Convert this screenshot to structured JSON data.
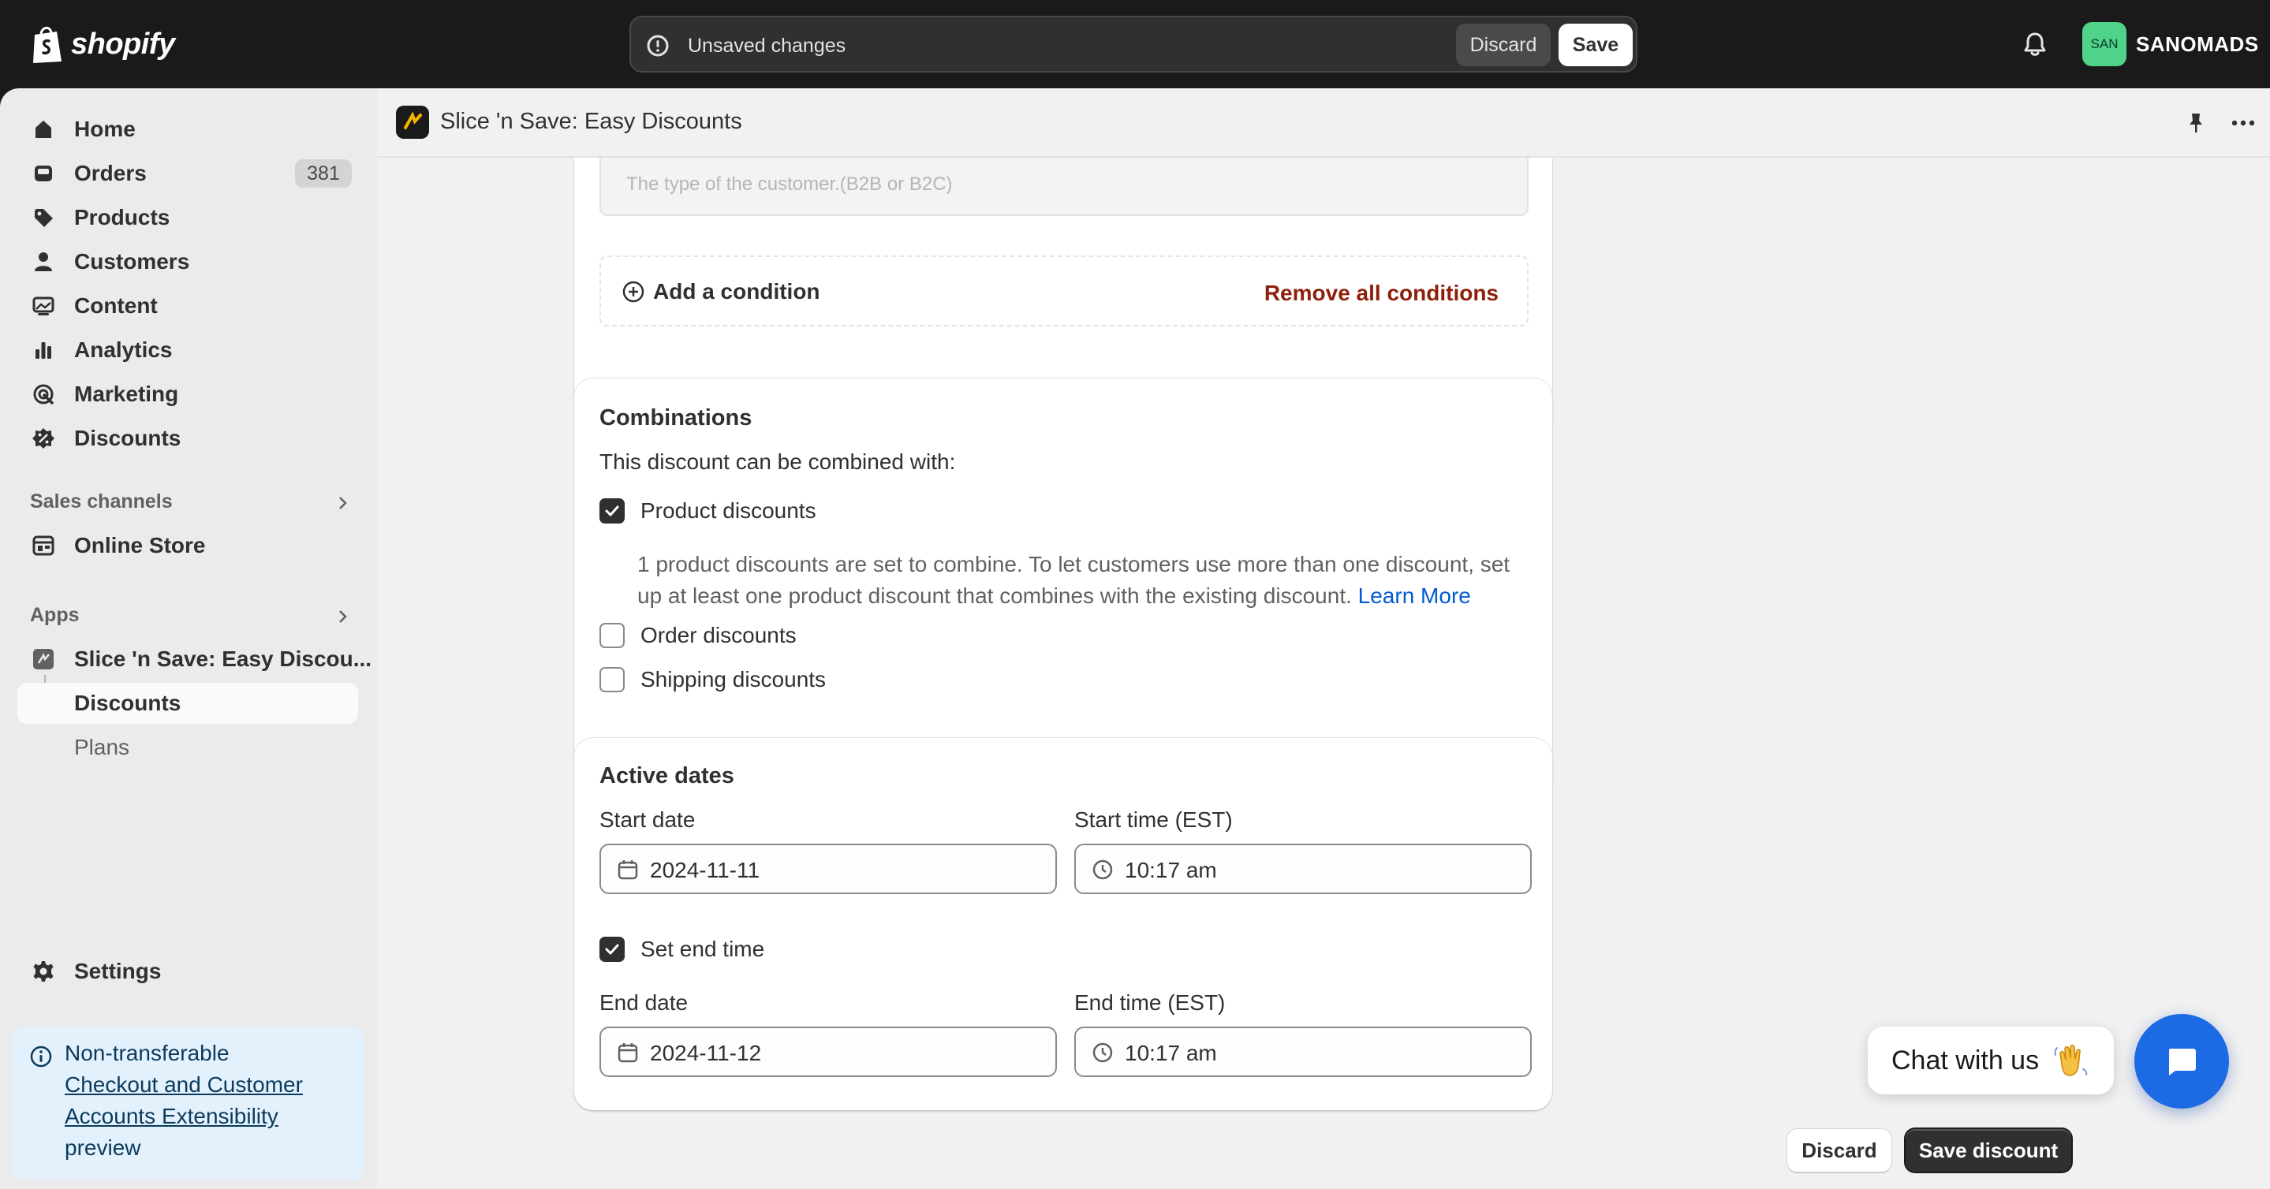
{
  "topbar": {
    "brand": "shopify",
    "unsaved_text": "Unsaved changes",
    "discard_label": "Discard",
    "save_label": "Save",
    "store_initials": "SAN",
    "store_name": "SANOMADS"
  },
  "sidebar": {
    "items": [
      {
        "label": "Home",
        "icon": "home-icon"
      },
      {
        "label": "Orders",
        "icon": "orders-icon",
        "badge": "381"
      },
      {
        "label": "Products",
        "icon": "tag-icon"
      },
      {
        "label": "Customers",
        "icon": "person-icon"
      },
      {
        "label": "Content",
        "icon": "content-icon"
      },
      {
        "label": "Analytics",
        "icon": "bar-chart-icon"
      },
      {
        "label": "Marketing",
        "icon": "target-icon"
      },
      {
        "label": "Discounts",
        "icon": "discount-icon"
      }
    ],
    "sales_channels_label": "Sales channels",
    "online_store_label": "Online Store",
    "apps_label": "Apps",
    "app_name": "Slice 'n Save: Easy Discou...",
    "app_sub_discounts": "Discounts",
    "app_sub_plans": "Plans",
    "settings_label": "Settings",
    "banner": {
      "title": "Non-transferable",
      "link": "Checkout and Customer Accounts Extensibility",
      "suffix": "preview"
    }
  },
  "header": {
    "app_title": "Slice 'n Save: Easy Discounts"
  },
  "conditions": {
    "placeholder": "The type of the customer.(B2B or B2C)",
    "add_label": "Add a condition",
    "remove_label": "Remove all conditions"
  },
  "combinations": {
    "title": "Combinations",
    "subtitle": "This discount can be combined with:",
    "product_label": "Product discounts",
    "product_checked": true,
    "help_text": "1 product discounts are set to combine. To let customers use more than one discount, set up at least one product discount that combines with the existing discount.",
    "learn_more": "Learn More",
    "order_label": "Order discounts",
    "order_checked": false,
    "shipping_label": "Shipping discounts",
    "shipping_checked": false
  },
  "active_dates": {
    "title": "Active dates",
    "start_date_label": "Start date",
    "start_date": "2024-11-11",
    "start_time_label": "Start time (EST)",
    "start_time": "10:17 am",
    "set_end_label": "Set end time",
    "set_end_checked": true,
    "end_date_label": "End date",
    "end_date": "2024-11-12",
    "end_time_label": "End time (EST)",
    "end_time": "10:17 am"
  },
  "chat": {
    "label": "Chat with us"
  },
  "footer": {
    "discard_label": "Discard",
    "save_label": "Save discount"
  },
  "colors": {
    "topbar": "#1a1a1a",
    "sidebar": "#ebebeb",
    "main_bg": "#f1f1f1",
    "critical": "#8e1f0b",
    "link": "#005bd3",
    "chat_fab": "#1d6ae5",
    "banner_bg": "#e3f1fd"
  }
}
